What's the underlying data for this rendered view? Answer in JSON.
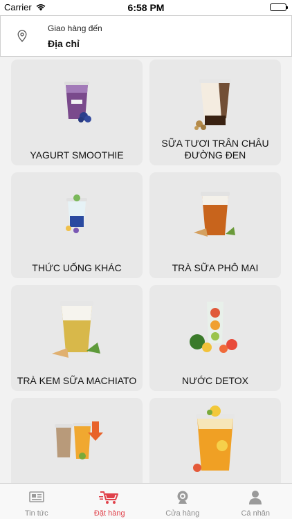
{
  "status_bar": {
    "carrier": "Carrier",
    "time": "6:58 PM"
  },
  "address": {
    "label": "Giao hàng đến",
    "value": "Địa chỉ"
  },
  "categories": [
    {
      "title": "YAGURT SMOOTHIE"
    },
    {
      "title": "SỮA TƯƠI TRÂN CHÂU ĐƯỜNG ĐEN"
    },
    {
      "title": "THỨC UỐNG KHÁC"
    },
    {
      "title": "TRÀ SỮA PHÔ MAI"
    },
    {
      "title": "TRÀ KEM SỮA MACHIATO"
    },
    {
      "title": "NƯỚC DETOX"
    },
    {
      "title": ""
    },
    {
      "title": ""
    }
  ],
  "tabs": [
    {
      "label": "Tin tức",
      "icon": "news-icon",
      "active": false
    },
    {
      "label": "Đặt hàng",
      "icon": "cart-icon",
      "active": true
    },
    {
      "label": "Cửa hàng",
      "icon": "store-icon",
      "active": false
    },
    {
      "label": "Cá nhân",
      "icon": "person-icon",
      "active": false
    }
  ],
  "colors": {
    "active_tab": "#e0414a",
    "inactive_tab": "#8e8e8e",
    "card_bg": "#e8e8e8"
  }
}
